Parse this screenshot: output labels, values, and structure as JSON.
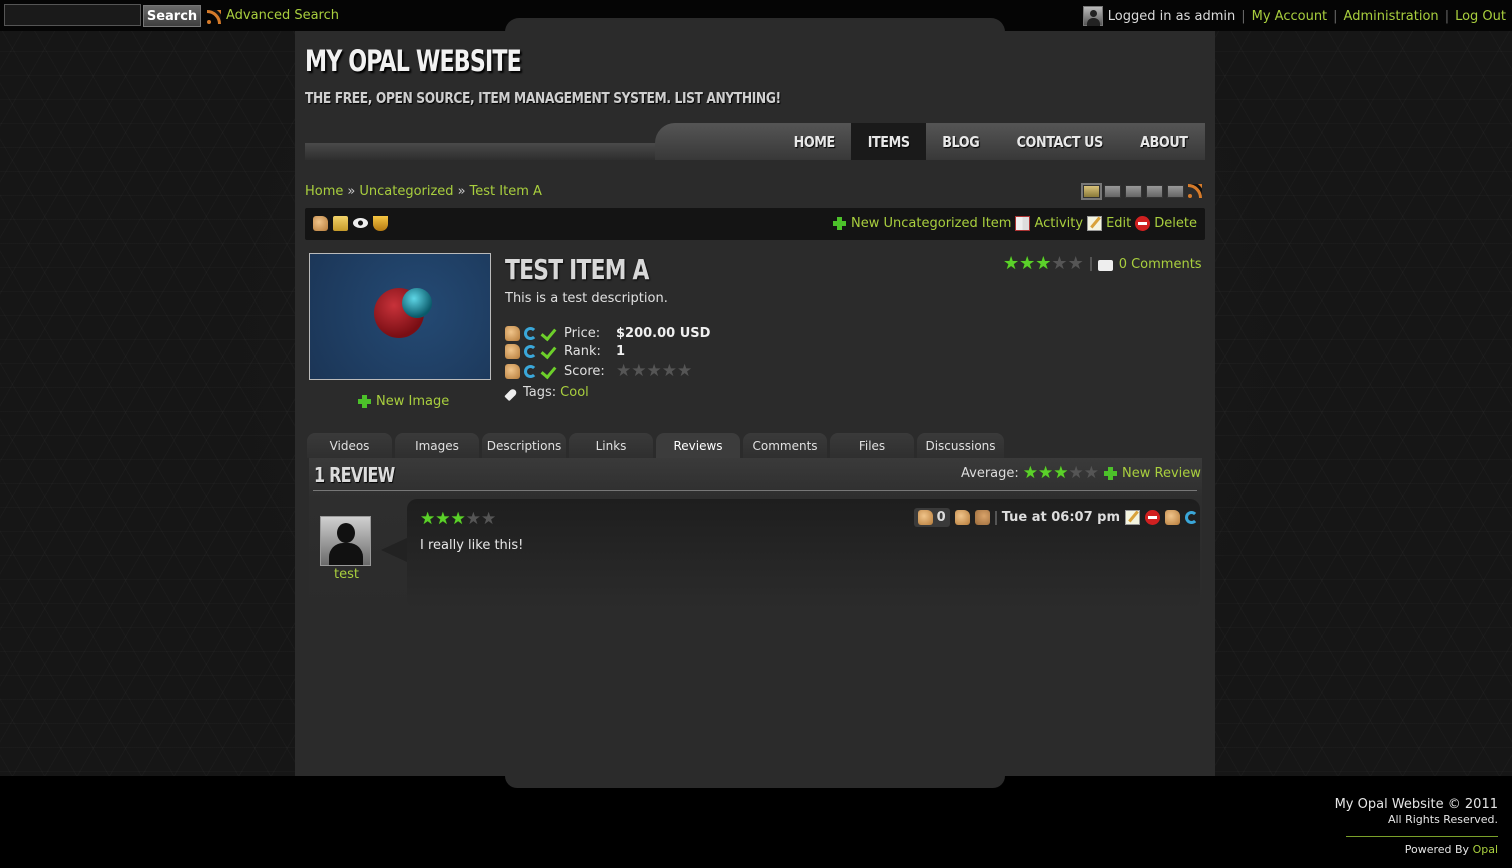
{
  "topbar": {
    "search_placeholder": "",
    "search_button": "Search",
    "advanced_search": "Advanced Search",
    "logged_in": "Logged in as admin",
    "my_account": "My Account",
    "administration": "Administration",
    "log_out": "Log Out",
    "separator": "|"
  },
  "site": {
    "title": "MY OPAL WEBSITE",
    "tagline": "THE FREE, OPEN SOURCE, ITEM MANAGEMENT SYSTEM. LIST ANYTHING!"
  },
  "nav": {
    "items": [
      {
        "label": "HOME",
        "active": false
      },
      {
        "label": "ITEMS",
        "active": true
      },
      {
        "label": "BLOG",
        "active": false
      },
      {
        "label": "CONTACT US",
        "active": false
      },
      {
        "label": "ABOUT",
        "active": false
      }
    ]
  },
  "breadcrumb": {
    "home": "Home",
    "category": "Uncategorized",
    "current": "Test Item A",
    "arrow": "»"
  },
  "toolbar": {
    "new_item": "New Uncategorized Item",
    "activity": "Activity",
    "edit": "Edit",
    "delete": "Delete"
  },
  "item": {
    "title": "TEST ITEM A",
    "description": "This is a test description.",
    "rating": 3,
    "rating_max": 5,
    "comments": "0 Comments",
    "new_image": "New Image",
    "fields": {
      "price_label": "Price:",
      "price_value": "$200.00 USD",
      "rank_label": "Rank:",
      "rank_value": "1",
      "score_label": "Score:",
      "score_value": 0
    },
    "tags_label": "Tags:",
    "tag": "Cool"
  },
  "tabs": [
    {
      "label": "Videos",
      "active": false
    },
    {
      "label": "Images",
      "active": false
    },
    {
      "label": "Descriptions",
      "active": false
    },
    {
      "label": "Links",
      "active": false
    },
    {
      "label": "Reviews",
      "active": true
    },
    {
      "label": "Comments",
      "active": false
    },
    {
      "label": "Files",
      "active": false
    },
    {
      "label": "Discussions",
      "active": false
    }
  ],
  "reviews": {
    "heading": "1 REVIEW",
    "average_label": "Average:",
    "average_rating": 3,
    "new_review": "New Review",
    "list": [
      {
        "user": "test",
        "rating": 3,
        "text": "I really like this!",
        "votes": "0",
        "date": "Tue at 06:07 pm"
      }
    ]
  },
  "footer": {
    "title": "My Opal Website © 2011",
    "rights": "All Rights Reserved.",
    "powered_prefix": "Powered By",
    "powered_link": "Opal"
  },
  "colors": {
    "link": "#a9cf3e",
    "star_on": "#5bd12a",
    "background": "#161616",
    "panel": "#2b2b2b"
  }
}
